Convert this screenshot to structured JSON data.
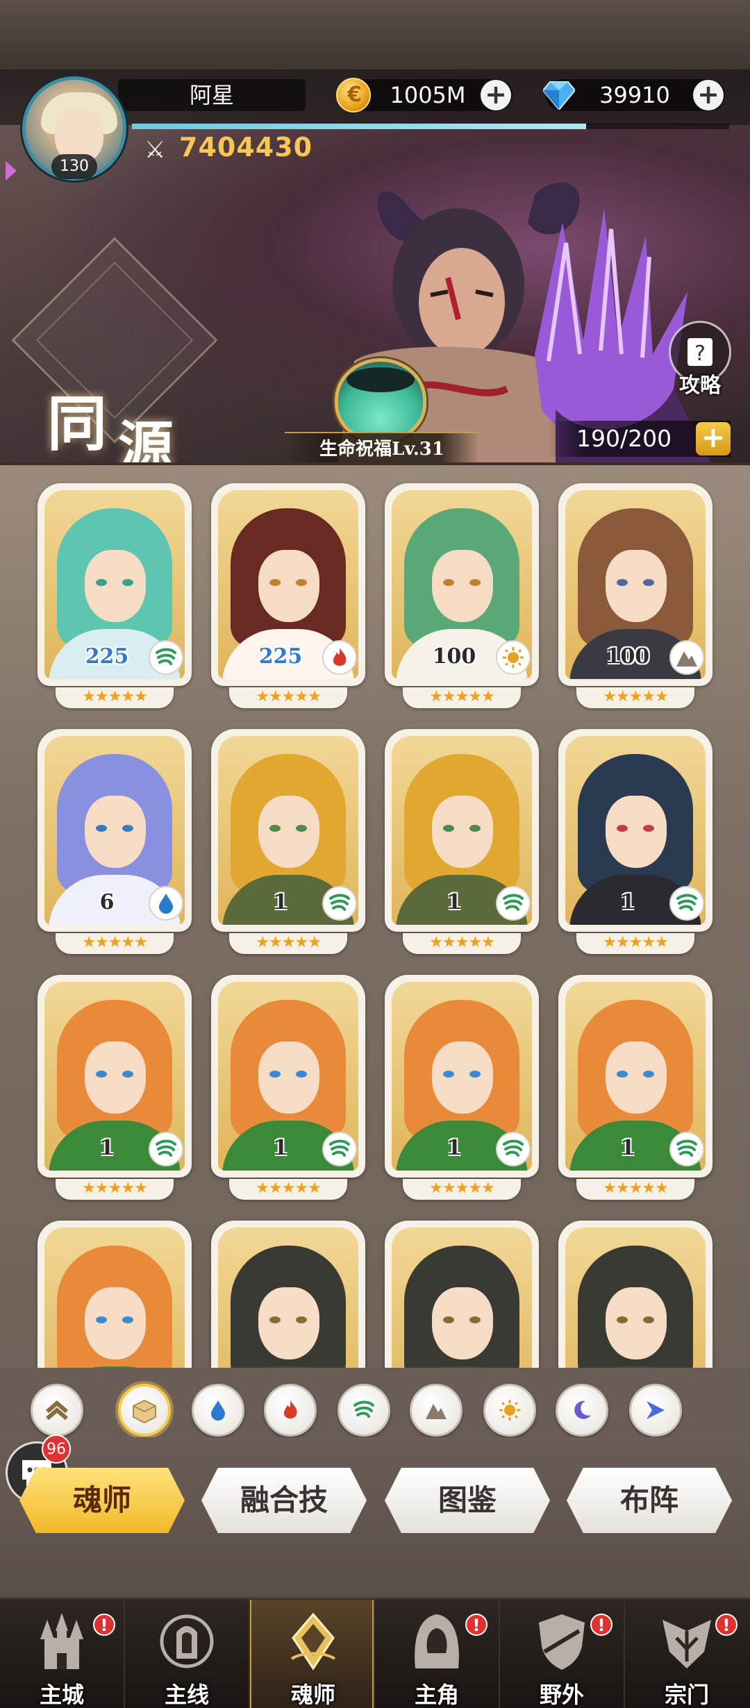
{
  "player": {
    "name": "阿星",
    "level": "130",
    "power": "7404430",
    "xp_fraction": 0.76
  },
  "resources": {
    "gold": "1005M",
    "gems": "39910"
  },
  "banner": {
    "title_char_1": "同",
    "title_char_2": "源",
    "guide_label": "攻略",
    "blessing_label": "生命祝福Lv.31",
    "capacity": "190/200"
  },
  "cards": [
    {
      "level": "225",
      "element": "wind",
      "level_color": "blue",
      "stars": "★★★★★",
      "hair": "#5ec6b0",
      "body": "#d9eef0",
      "eye": "#3aa08a"
    },
    {
      "level": "225",
      "element": "fire",
      "level_color": "blue",
      "stars": "★★★★★",
      "hair": "#6a2a24",
      "body": "#fff4ee",
      "eye": "#c08030"
    },
    {
      "level": "100",
      "element": "light",
      "level_color": "dark",
      "stars": "★★★★★",
      "hair": "#5aa878",
      "body": "#f6f2ea",
      "eye": "#c08030"
    },
    {
      "level": "100",
      "element": "earth",
      "level_color": "dark",
      "stars": "★★★★★",
      "hair": "#8a5a3a",
      "body": "#3a3a42",
      "eye": "#4a6aa0"
    },
    {
      "level": "6",
      "element": "water",
      "level_color": "dark",
      "stars": "★★★★★",
      "hair": "#8a90e0",
      "body": "#eef0fa",
      "eye": "#3a7ac0"
    },
    {
      "level": "1",
      "element": "wind",
      "level_color": "dark",
      "stars": "★★★★★",
      "hair": "#e0a830",
      "body": "#5a6a3a",
      "eye": "#4a8a4a"
    },
    {
      "level": "1",
      "element": "wind",
      "level_color": "dark",
      "stars": "★★★★★",
      "hair": "#e0a830",
      "body": "#5a6a3a",
      "eye": "#4a8a4a"
    },
    {
      "level": "1",
      "element": "wind",
      "level_color": "dark",
      "stars": "★★★★★",
      "hair": "#2a3a50",
      "body": "#2a2a30",
      "eye": "#c04040"
    },
    {
      "level": "1",
      "element": "wind",
      "level_color": "dark",
      "stars": "★★★★★",
      "hair": "#e88a3a",
      "body": "#3a8a3a",
      "eye": "#3a8ad0"
    },
    {
      "level": "1",
      "element": "wind",
      "level_color": "dark",
      "stars": "★★★★★",
      "hair": "#e88a3a",
      "body": "#3a8a3a",
      "eye": "#3a8ad0"
    },
    {
      "level": "1",
      "element": "wind",
      "level_color": "dark",
      "stars": "★★★★★",
      "hair": "#e88a3a",
      "body": "#3a8a3a",
      "eye": "#3a8ad0"
    },
    {
      "level": "1",
      "element": "wind",
      "level_color": "dark",
      "stars": "★★★★★",
      "hair": "#e88a3a",
      "body": "#3a8a3a",
      "eye": "#3a8ad0"
    },
    {
      "level": "",
      "element": "",
      "level_color": "dark",
      "stars": "",
      "hair": "#e88a3a",
      "body": "#3a8a3a",
      "eye": "#3a8ad0"
    },
    {
      "level": "",
      "element": "",
      "level_color": "dark",
      "stars": "",
      "hair": "#3a3a34",
      "body": "#4a4a40",
      "eye": "#8a6a30"
    },
    {
      "level": "",
      "element": "",
      "level_color": "dark",
      "stars": "",
      "hair": "#3a3a34",
      "body": "#4a4a40",
      "eye": "#8a6a30"
    },
    {
      "level": "",
      "element": "",
      "level_color": "dark",
      "stars": "",
      "hair": "#3a3a34",
      "body": "#4a4a40",
      "eye": "#8a6a30"
    }
  ],
  "filters": [
    {
      "icon": "rank-chevron-icon",
      "active": false
    },
    {
      "icon": "all-box-icon",
      "active": true
    },
    {
      "icon": "water-drop-icon",
      "active": false
    },
    {
      "icon": "fire-icon",
      "active": false
    },
    {
      "icon": "wind-icon",
      "active": false
    },
    {
      "icon": "earth-mountain-icon",
      "active": false
    },
    {
      "icon": "light-sun-icon",
      "active": false
    },
    {
      "icon": "dark-moon-icon",
      "active": false
    },
    {
      "icon": "special-triangle-icon",
      "active": false
    }
  ],
  "chat": {
    "badge": "96"
  },
  "tabs": [
    {
      "label": "魂师",
      "active": true
    },
    {
      "label": "融合技",
      "active": false
    },
    {
      "label": "图鉴",
      "active": false
    },
    {
      "label": "布阵",
      "active": false
    }
  ],
  "nav": [
    {
      "label": "主城",
      "icon": "castle-icon",
      "alert": "!",
      "active": false
    },
    {
      "label": "主线",
      "icon": "main-quest-icon",
      "alert": "",
      "active": false
    },
    {
      "label": "魂师",
      "icon": "soul-master-icon",
      "alert": "",
      "active": true
    },
    {
      "label": "主角",
      "icon": "hero-hood-icon",
      "alert": "!",
      "active": false
    },
    {
      "label": "野外",
      "icon": "field-shield-icon",
      "alert": "!",
      "active": false
    },
    {
      "label": "宗门",
      "icon": "sect-crest-icon",
      "alert": "!",
      "active": false
    }
  ],
  "colors": {
    "accent_gold": "#f5c94a",
    "power_gold": "#f6c65a",
    "alert_red": "#e03030",
    "level_blue": "#2f7ad0"
  }
}
